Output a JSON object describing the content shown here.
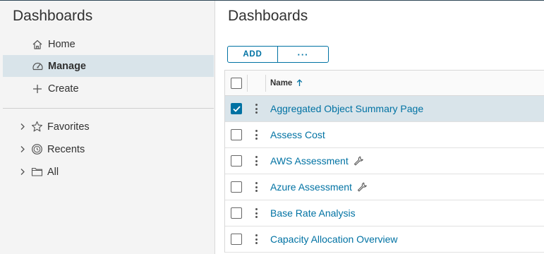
{
  "left_panel": {
    "title": "Dashboards",
    "nav": [
      {
        "label": "Home",
        "icon": "home-icon",
        "active": false
      },
      {
        "label": "Manage",
        "icon": "speedometer-icon",
        "active": true
      },
      {
        "label": "Create",
        "icon": "plus-icon",
        "active": false
      }
    ],
    "tree": [
      {
        "label": "Favorites",
        "icon": "star-icon"
      },
      {
        "label": "Recents",
        "icon": "clock-icon"
      },
      {
        "label": "All",
        "icon": "folder-icon"
      }
    ]
  },
  "main": {
    "title": "Dashboards",
    "toolbar": {
      "add_label": "ADD",
      "more_label": "···"
    },
    "grid": {
      "columns": [
        {
          "label": "Name",
          "sort": "ascending"
        }
      ],
      "rows": [
        {
          "name": "Aggregated Object Summary Page",
          "selected": true,
          "wrench": false
        },
        {
          "name": "Assess Cost",
          "selected": false,
          "wrench": false
        },
        {
          "name": "AWS Assessment",
          "selected": false,
          "wrench": true
        },
        {
          "name": "Azure Assessment",
          "selected": false,
          "wrench": true
        },
        {
          "name": "Base Rate Analysis",
          "selected": false,
          "wrench": false
        },
        {
          "name": "Capacity Allocation Overview",
          "selected": false,
          "wrench": false
        }
      ]
    }
  },
  "colors": {
    "accent": "#0072a3",
    "selected_bg": "#d9e4ea",
    "sidebar_bg": "#f4f4f4",
    "text": "#313131"
  }
}
